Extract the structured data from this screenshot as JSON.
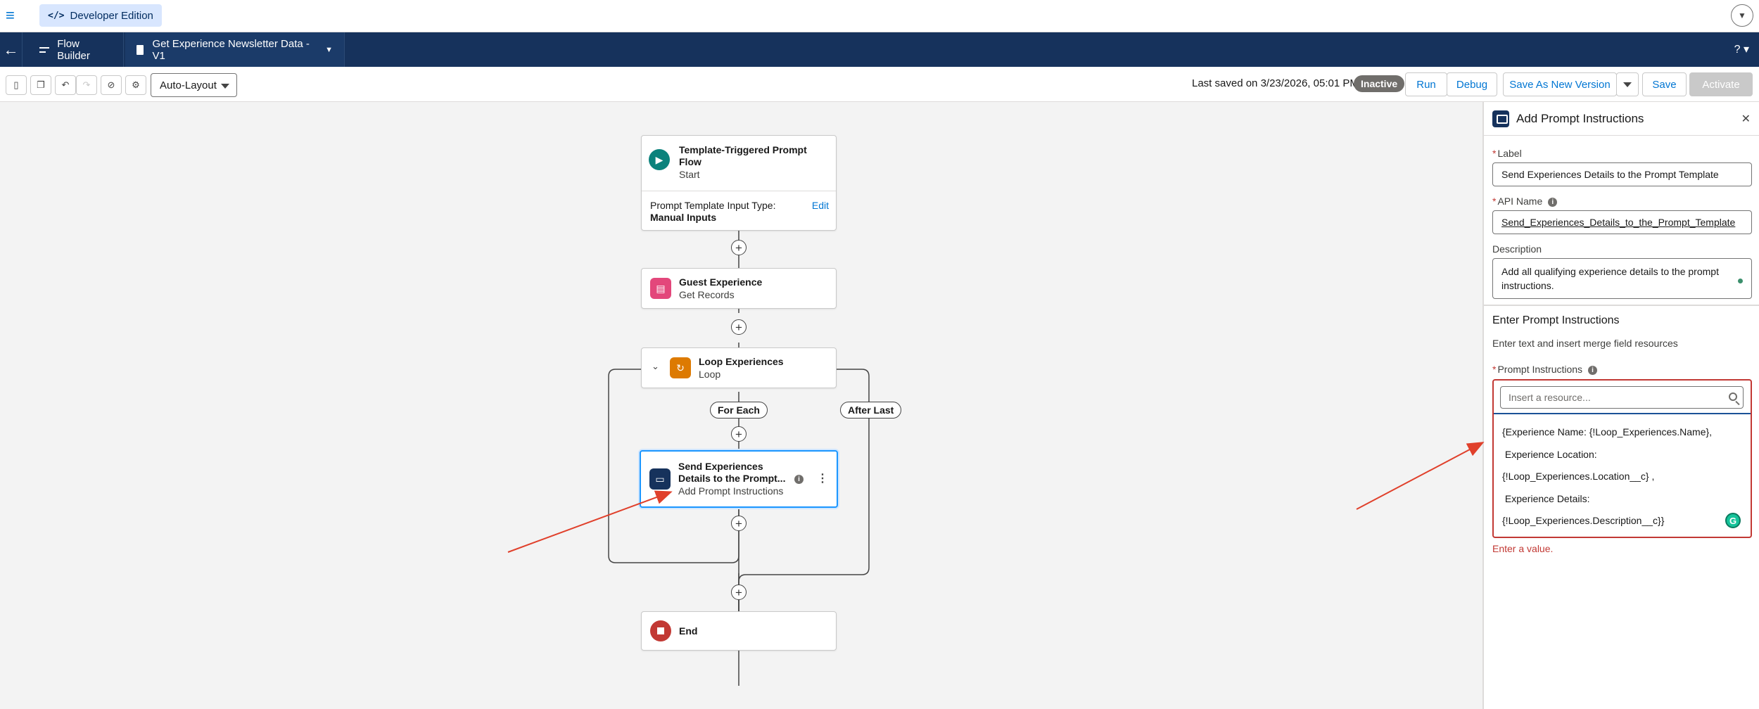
{
  "top_bar": {
    "badge_label": "Developer Edition"
  },
  "app_bar": {
    "app_name": "Flow Builder",
    "flow_name": "Get Experience Newsletter Data - V1",
    "help_label": "? ▾"
  },
  "toolbar": {
    "layout_select": "Auto-Layout",
    "last_saved": "Last saved on 3/23/2026, 05:01 PM",
    "status": "Inactive",
    "run": "Run",
    "debug": "Debug",
    "save_as_new_version": "Save As New Version",
    "save": "Save",
    "activate": "Activate"
  },
  "canvas": {
    "start": {
      "title": "Template-Triggered Prompt Flow",
      "subtitle": "Start",
      "input_type_label": "Prompt Template Input Type:",
      "input_type_value": "Manual Inputs",
      "edit": "Edit"
    },
    "get_records": {
      "title": "Guest Experience",
      "subtitle": "Get Records"
    },
    "loop": {
      "title": "Loop Experiences",
      "subtitle": "Loop"
    },
    "for_each": "For Each",
    "after_last": "After Last",
    "prompt_node": {
      "title_line1": "Send Experiences",
      "title_line2": "Details to the Prompt...",
      "subtitle": "Add Prompt Instructions"
    },
    "end": {
      "title": "End"
    }
  },
  "panel": {
    "title": "Add Prompt Instructions",
    "label_label": "Label",
    "label_value": "Send Experiences Details to the Prompt Template",
    "api_label": "API Name",
    "api_value": "Send_Experiences_Details_to_the_Prompt_Template",
    "description_label": "Description",
    "description_value": "Add all qualifying experience details to the prompt instructions.",
    "section_title": "Enter Prompt Instructions",
    "section_helper": "Enter text and insert merge field resources",
    "instructions_label": "Prompt Instructions",
    "resource_placeholder": "Insert a resource...",
    "instructions_lines": [
      "{Experience Name: {!Loop_Experiences.Name},",
      " Experience Location:",
      "{!Loop_Experiences.Location__c} ,",
      " Experience Details:",
      "{!Loop_Experiences.Description__c}}"
    ],
    "error": "Enter a value."
  },
  "colors": {
    "navy": "#16325c",
    "brand_blue": "#0176d3",
    "error_red": "#c23934",
    "arrow_red": "#e0402b"
  }
}
